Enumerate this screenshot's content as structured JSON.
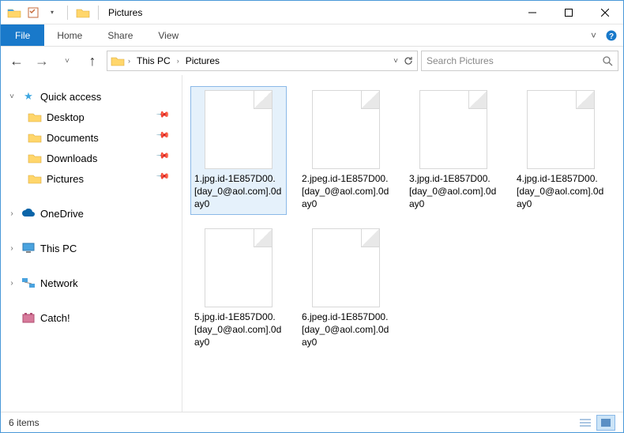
{
  "window": {
    "title": "Pictures"
  },
  "ribbon": {
    "file": "File",
    "tabs": [
      "Home",
      "Share",
      "View"
    ]
  },
  "breadcrumb": {
    "segments": [
      "This PC",
      "Pictures"
    ]
  },
  "search": {
    "placeholder": "Search Pictures"
  },
  "nav": {
    "quick_access": {
      "label": "Quick access",
      "items": [
        {
          "label": "Desktop",
          "pinned": true
        },
        {
          "label": "Documents",
          "pinned": true
        },
        {
          "label": "Downloads",
          "pinned": true
        },
        {
          "label": "Pictures",
          "pinned": true
        }
      ]
    },
    "onedrive": "OneDrive",
    "thispc": "This PC",
    "network": "Network",
    "catch": "Catch!"
  },
  "files": [
    "1.jpg.id-1E857D00.[day_0@aol.com].0day0",
    "2.jpeg.id-1E857D00.[day_0@aol.com].0day0",
    "3.jpg.id-1E857D00.[day_0@aol.com].0day0",
    "4.jpg.id-1E857D00.[day_0@aol.com].0day0",
    "5.jpg.id-1E857D00.[day_0@aol.com].0day0",
    "6.jpeg.id-1E857D00.[day_0@aol.com].0day0"
  ],
  "status": {
    "text": "6 items"
  }
}
